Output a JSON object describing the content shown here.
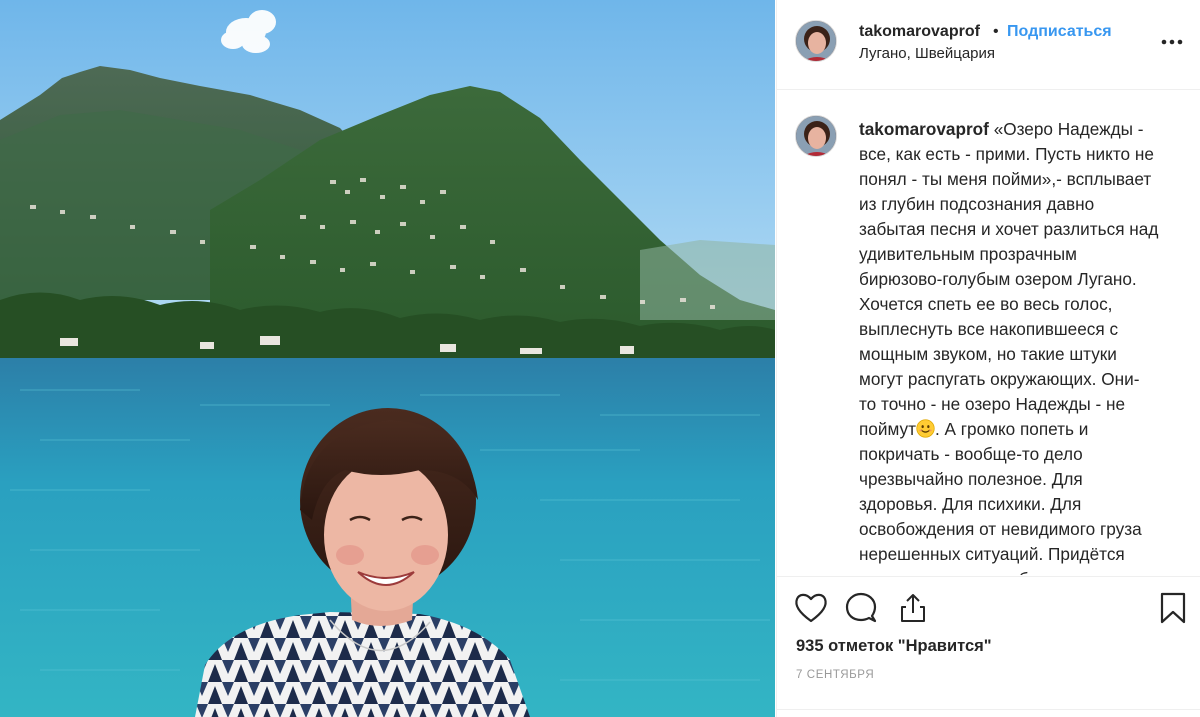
{
  "post": {
    "username": "takomarovaprof",
    "separator": "•",
    "follow_label": "Подписаться",
    "location": "Лугано, Швейцария",
    "caption_author": "takomarovaprof",
    "caption_body": "«Озеро Надежды -\nвсе, как есть - прими. Пусть никто не\nпонял - ты меня пойми»,- всплывает\nиз глубин подсознания давно\nзабытая песня и хочет разлиться над\nудивительным прозрачным\nбирюзово-голубым озером Лугано.\nХочется спеть ее во весь голос,\nвыплеснуть все накопившееся с\nмощным звуком, но такие штуки\nмогут распугать окружающих. Они-\nто точно - не озеро Надежды - не\nпоймут",
    "caption_tail": ". А громко попеть и\nпокричать - вообще-то дело\nчрезвычайно полезное. Для\nздоровья. Для психики. Для\nосвобождения от невидимого груза\nнерешенных ситуаций. Придётся\nпоискать место, свободное от\nименения живе переживать с мои",
    "likes_label": "935 отметок \"Нравится\"",
    "date": "7 сентября"
  },
  "icons": {
    "more": "more-horizontal-icon",
    "like": "heart-icon",
    "comment": "comment-icon",
    "share": "share-icon",
    "save": "bookmark-icon",
    "smiley": "smiling-face-emoji"
  },
  "colors": {
    "accent": "#3897f0",
    "text": "#262626",
    "muted": "#999999",
    "divider": "#efefef",
    "sky": "#8fc6ee",
    "lake": "#2d9cbf"
  }
}
